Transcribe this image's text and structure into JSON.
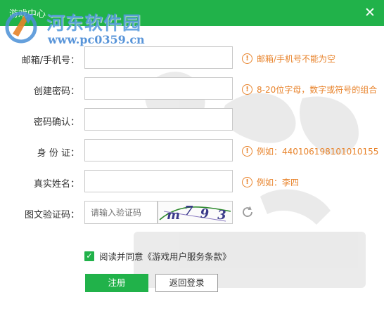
{
  "window": {
    "title": "游戏中心",
    "close_glyph": "✕"
  },
  "watermark": {
    "name": "河东软件园",
    "url": "www.pc0359.cn"
  },
  "form": {
    "email": {
      "label": "邮箱/手机号：",
      "value": "",
      "hint": "邮箱/手机号不能为空"
    },
    "password": {
      "label": "创建密码：",
      "value": "",
      "hint": "8-20位字母，数字或符号的组合"
    },
    "confirm": {
      "label": "密码确认：",
      "value": ""
    },
    "id_card": {
      "label": "身 份 证：",
      "value": "",
      "hint": "例如：440106198101010155"
    },
    "real_name": {
      "label": "真实姓名：",
      "value": "",
      "hint": "例如：李四"
    },
    "captcha": {
      "label": "图文验证码：",
      "placeholder": "请输入验证码",
      "image_text": "m793"
    }
  },
  "hint_icon": "!",
  "agreement": {
    "checked": true,
    "check_glyph": "✓",
    "text": "阅读并同意《游戏用户服务条款》"
  },
  "buttons": {
    "register": "注册",
    "back_login": "返回登录"
  },
  "colors": {
    "accent": "#21b24a",
    "hint": "#e8832b",
    "watermark": "#4a8fd6"
  }
}
